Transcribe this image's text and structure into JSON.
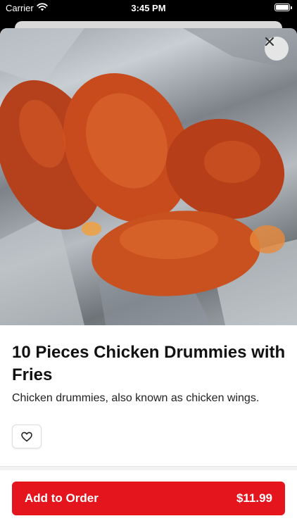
{
  "status_bar": {
    "carrier": "Carrier",
    "time": "3:45 PM",
    "icons": [
      "wifi-icon",
      "battery-icon"
    ]
  },
  "item": {
    "image_alt": "Chicken drummies on foil",
    "title": "10 Pieces Chicken Drummies with Fries",
    "description": "Chicken drummies, also known as chicken wings.",
    "icons": [
      "close-icon",
      "heart-icon"
    ]
  },
  "order": {
    "add_label": "Add to Order",
    "price": "$11.99"
  },
  "colors": {
    "accent": "#e4151d",
    "text": "#111111"
  }
}
